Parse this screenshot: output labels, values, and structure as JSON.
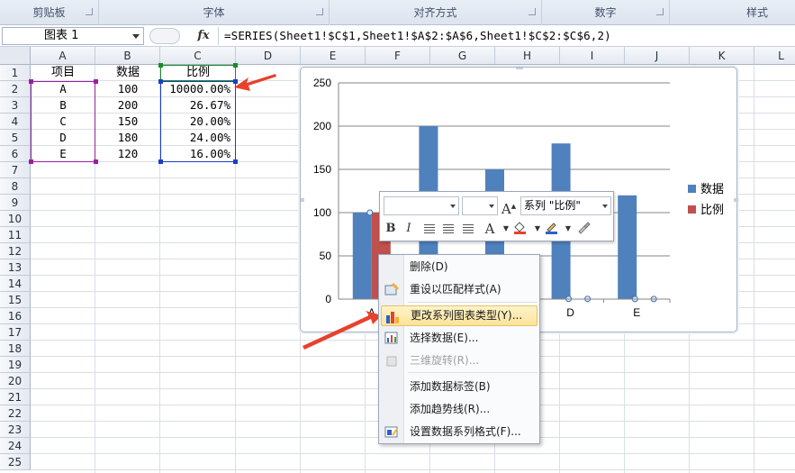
{
  "ribbon": {
    "groups": [
      "剪贴板",
      "字体",
      "对齐方式",
      "数字",
      "样式"
    ]
  },
  "formula_bar": {
    "name_box": "图表 1",
    "fx_label": "fx",
    "formula": "=SERIES(Sheet1!$C$1,Sheet1!$A$2:$A$6,Sheet1!$C$2:$C$6,2)"
  },
  "sheet": {
    "columns": [
      "A",
      "B",
      "C",
      "D",
      "E",
      "F",
      "G",
      "H",
      "I",
      "J",
      "K",
      "L"
    ],
    "rows": [
      "1",
      "2",
      "3",
      "4",
      "5",
      "6",
      "7",
      "8",
      "9",
      "10",
      "11",
      "12",
      "13",
      "14",
      "15",
      "16",
      "17",
      "18",
      "19",
      "20",
      "21",
      "22",
      "23",
      "24",
      "25"
    ],
    "header": [
      "项目",
      "数据",
      "比例"
    ],
    "data": [
      [
        "A",
        "100",
        "10000.00%"
      ],
      [
        "B",
        "200",
        "26.67%"
      ],
      [
        "C",
        "150",
        "20.00%"
      ],
      [
        "D",
        "180",
        "24.00%"
      ],
      [
        "E",
        "120",
        "16.00%"
      ]
    ]
  },
  "chart_data": {
    "type": "bar",
    "categories": [
      "A",
      "B",
      "C",
      "D",
      "E"
    ],
    "series": [
      {
        "name": "数据",
        "values": [
          100,
          200,
          150,
          180,
          120
        ],
        "color": "#4f81bd"
      },
      {
        "name": "比例",
        "values": [
          100,
          0.2667,
          0.2,
          0.24,
          0.16
        ],
        "color": "#c0504d"
      }
    ],
    "yticks": [
      "0",
      "50",
      "100",
      "150",
      "200",
      "250"
    ],
    "ylim": [
      0,
      250
    ],
    "legend_position": "right",
    "grid": true
  },
  "mini_toolbar": {
    "font_name": "",
    "font_size": "",
    "series_select": "系列 \"比例\"",
    "grow_font": "A",
    "shrink_font": "A",
    "bold": "B",
    "italic": "I",
    "font_color": "A"
  },
  "context_menu": {
    "items": [
      {
        "label": "删除(D)",
        "enabled": true,
        "icon": ""
      },
      {
        "label": "重设以匹配样式(A)",
        "enabled": true,
        "icon": "reset-style-icon"
      },
      {
        "label": "更改系列图表类型(Y)...",
        "enabled": true,
        "icon": "change-chart-type-icon",
        "highlighted": true
      },
      {
        "label": "选择数据(E)...",
        "enabled": true,
        "icon": "select-data-icon"
      },
      {
        "label": "三维旋转(R)...",
        "enabled": false,
        "icon": "3d-rotation-icon"
      },
      {
        "label": "添加数据标签(B)",
        "enabled": true,
        "icon": ""
      },
      {
        "label": "添加趋势线(R)...",
        "enabled": true,
        "icon": ""
      },
      {
        "label": "设置数据系列格式(F)...",
        "enabled": true,
        "icon": "format-series-icon"
      }
    ]
  },
  "colors": {
    "series1": "#4f81bd",
    "series2": "#c0504d",
    "arrow": "#e8412d",
    "range_a": "#9b1fa0",
    "range_b": "#1b3fc2",
    "range_c": "#1a8a2b"
  }
}
